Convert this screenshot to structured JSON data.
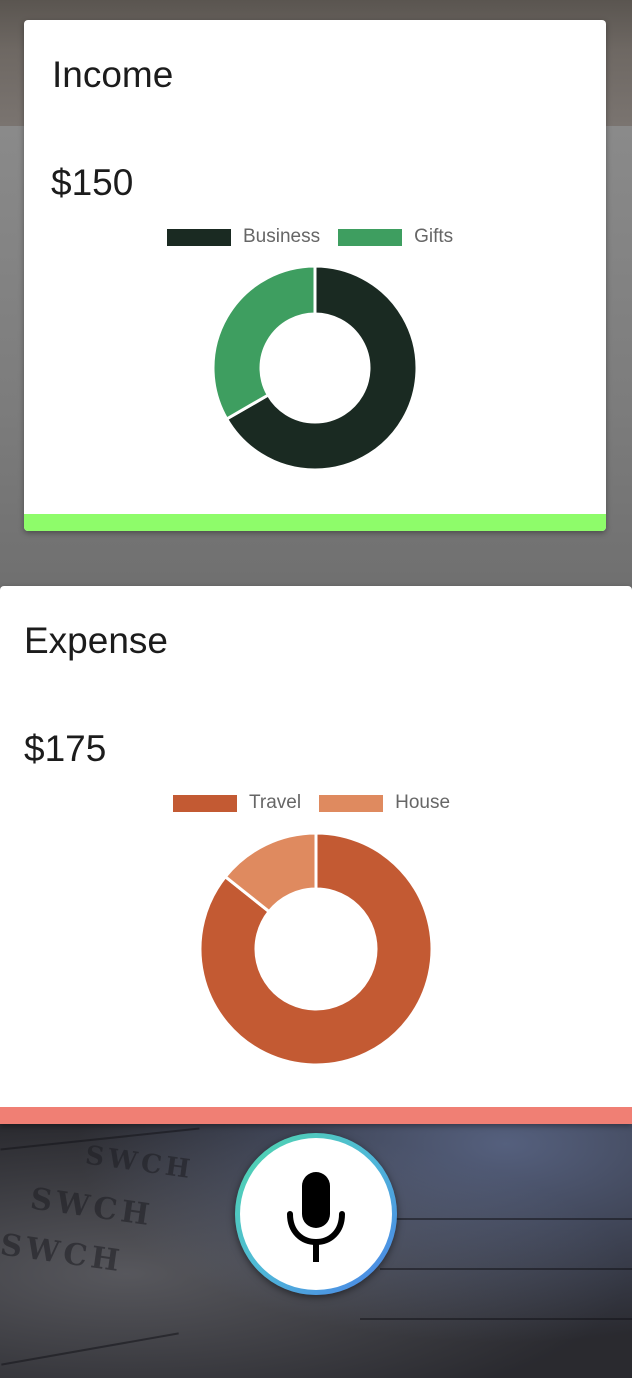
{
  "income": {
    "title": "Income",
    "amount": "$150",
    "accent_color": "#8efc6a",
    "legend": [
      {
        "label": "Business",
        "color": "#1a2a22"
      },
      {
        "label": "Gifts",
        "color": "#3e9e60"
      }
    ]
  },
  "expense": {
    "title": "Expense",
    "amount": "$175",
    "accent_color": "#f07f74",
    "legend": [
      {
        "label": "Travel",
        "color": "#c35a33"
      },
      {
        "label": "House",
        "color": "#df8a5f"
      }
    ]
  },
  "chart_data": [
    {
      "type": "pie",
      "categories": [
        "Business",
        "Gifts"
      ],
      "values": [
        100,
        50
      ],
      "colors": [
        "#1a2a22",
        "#3e9e60"
      ],
      "legend": "top"
    },
    {
      "type": "pie",
      "categories": [
        "Travel",
        "House"
      ],
      "values": [
        150,
        25
      ],
      "colors": [
        "#c35a33",
        "#df8a5f"
      ],
      "legend": "top"
    }
  ],
  "mic": {
    "icon": "microphone-icon"
  }
}
